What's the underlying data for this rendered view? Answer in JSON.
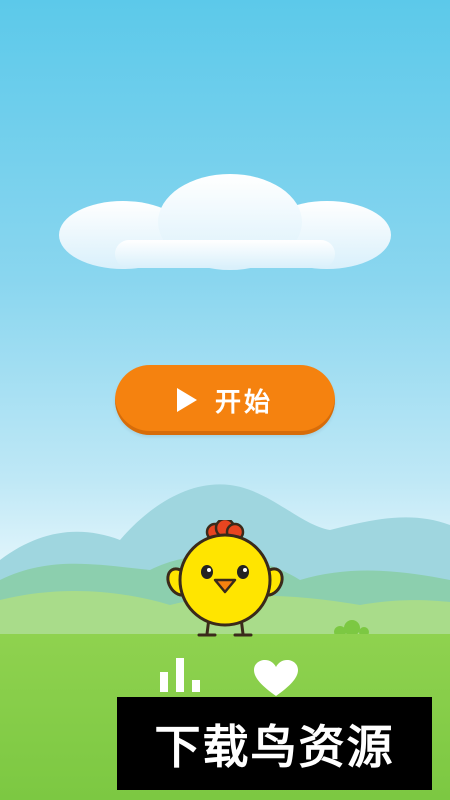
{
  "game": {
    "start_label": "开始"
  },
  "bottom_bar": {
    "stats_icon": "bar-chart-icon",
    "favorite_icon": "heart-icon"
  },
  "watermark": {
    "text": "下载鸟资源"
  },
  "colors": {
    "sky_top": "#5cc9ea",
    "start_button": "#f5820f",
    "grass": "#8fd24f",
    "chick_body": "#ffe500"
  }
}
